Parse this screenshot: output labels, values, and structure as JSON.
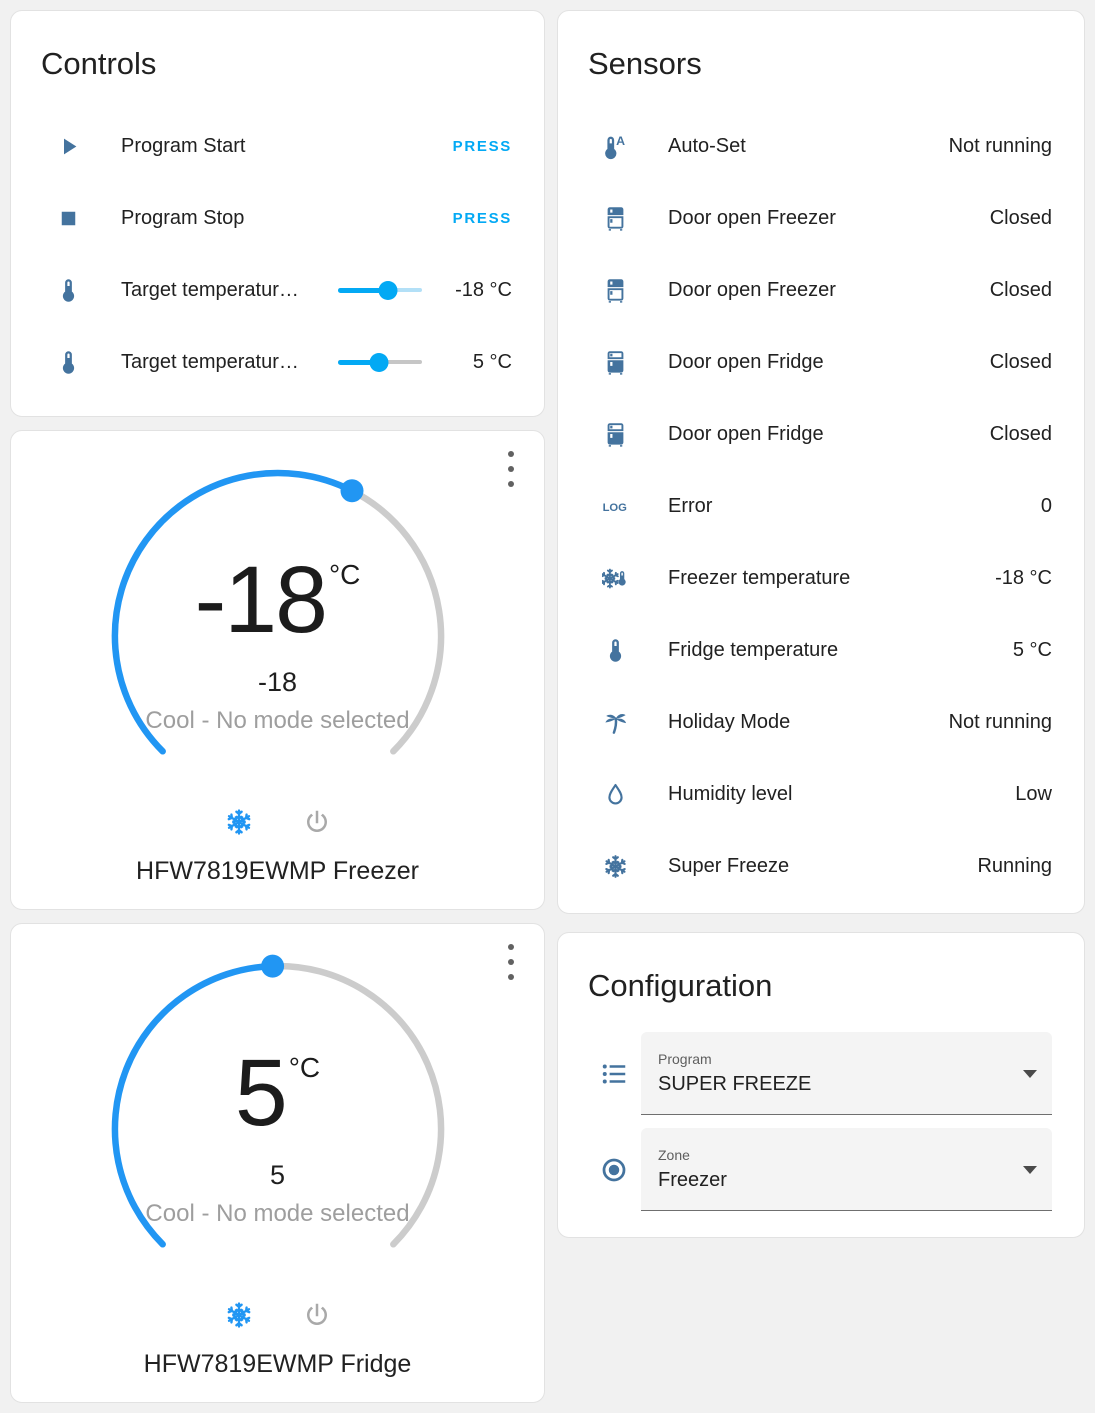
{
  "colors": {
    "accent": "#03a9f4",
    "icon_steel_blue": "#44739e",
    "dial_blue": "#2196f3",
    "dial_gray": "#cccccc",
    "status_gray": "#9e9e9e",
    "page_bg": "#f1f1f1",
    "card_bg": "#ffffff"
  },
  "icons": {
    "log_text": "LOG",
    "auto_letter": "A"
  },
  "controls": {
    "title": "Controls",
    "rows": [
      {
        "icon": "play-icon",
        "label": "Program Start",
        "action": "PRESS"
      },
      {
        "icon": "stop-icon",
        "label": "Program Stop",
        "action": "PRESS"
      },
      {
        "icon": "thermometer-icon",
        "label": "Target temperatur…",
        "value": "-18 °C",
        "slider_percent": 60
      },
      {
        "icon": "thermometer-icon",
        "label": "Target temperatur…",
        "value": "5 °C",
        "slider_percent": 49
      }
    ]
  },
  "freezer": {
    "target_temp": "-18",
    "unit": "°C",
    "current_temp": "-18",
    "status": "Cool - No mode selected",
    "name": "HFW7819EWMP Freezer",
    "modes": [
      {
        "icon": "snowflake-icon",
        "active": true
      },
      {
        "icon": "power-icon",
        "active": false
      }
    ]
  },
  "fridge": {
    "target_temp": "5",
    "unit": "°C",
    "current_temp": "5",
    "status": "Cool - No mode selected",
    "name": "HFW7819EWMP Fridge",
    "modes": [
      {
        "icon": "snowflake-icon",
        "active": true
      },
      {
        "icon": "power-icon",
        "active": false
      }
    ]
  },
  "sensors": {
    "title": "Sensors",
    "rows": [
      {
        "icon": "thermometer-auto-icon",
        "label": "Auto-Set",
        "value": "Not running"
      },
      {
        "icon": "fridge-bottom-open-icon",
        "label": "Door open Freezer",
        "value": "Closed"
      },
      {
        "icon": "fridge-bottom-open-icon",
        "label": "Door open Freezer",
        "value": "Closed"
      },
      {
        "icon": "fridge-top-open-icon",
        "label": "Door open Fridge",
        "value": "Closed"
      },
      {
        "icon": "fridge-top-open-icon",
        "label": "Door open Fridge",
        "value": "Closed"
      },
      {
        "icon": "log-icon",
        "label": "Error",
        "value": "0"
      },
      {
        "icon": "snowflake-thermometer-icon",
        "label": "Freezer temperature",
        "value": "-18 °C"
      },
      {
        "icon": "thermometer-icon",
        "label": "Fridge temperature",
        "value": "5 °C"
      },
      {
        "icon": "palm-tree-icon",
        "label": "Holiday Mode",
        "value": "Not running"
      },
      {
        "icon": "water-drop-icon",
        "label": "Humidity level",
        "value": "Low"
      },
      {
        "icon": "snowflake-icon",
        "label": "Super Freeze",
        "value": "Running"
      }
    ]
  },
  "config": {
    "title": "Configuration",
    "fields": [
      {
        "icon": "list-icon",
        "label": "Program",
        "value": "SUPER FREEZE"
      },
      {
        "icon": "radiobox-icon",
        "label": "Zone",
        "value": "Freezer"
      }
    ]
  }
}
